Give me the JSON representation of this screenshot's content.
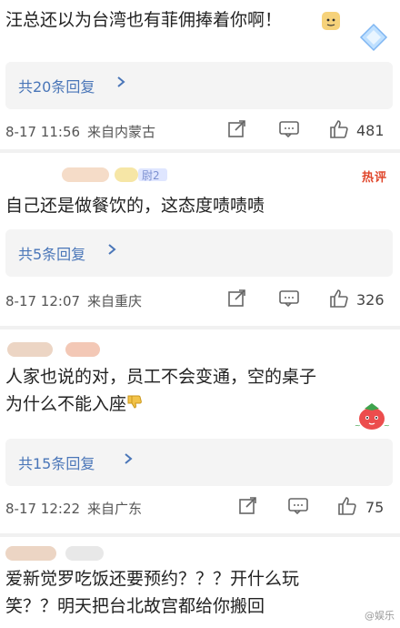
{
  "comments": [
    {
      "text": "汪总还以为台湾也有菲佣捧着你啊！",
      "reply_label": "共20条回复",
      "time": "8-17 11:56",
      "from": "来自内蒙古",
      "likes": "481",
      "icons": {
        "share": "share-icon",
        "comment": "comment-icon",
        "like": "thumbs-up-icon"
      }
    },
    {
      "user_level": "尉2",
      "hot_label": "热评",
      "text": "自己还是做餐饮的，这态度啧啧啧",
      "reply_label": "共5条回复",
      "time": "8-17 12:07",
      "from": "来自重庆",
      "likes": "326"
    },
    {
      "text_line1": "人家也说的对，员工不会变通，空的桌子",
      "text_line2": "为什么不能入座",
      "reply_label": "共15条回复",
      "time": "8-17 12:22",
      "from": "来自广东",
      "likes": "75"
    },
    {
      "text_line1": "爱新觉罗吃饭还要预约？？？开什么玩",
      "text_line2": "笑？？明天把台北故宫都给你搬回",
      "watermark": "@娱乐"
    }
  ],
  "colors": {
    "link": "#4a76b8",
    "hot": "#e0462b",
    "reply_bg": "#f4f4f4"
  }
}
